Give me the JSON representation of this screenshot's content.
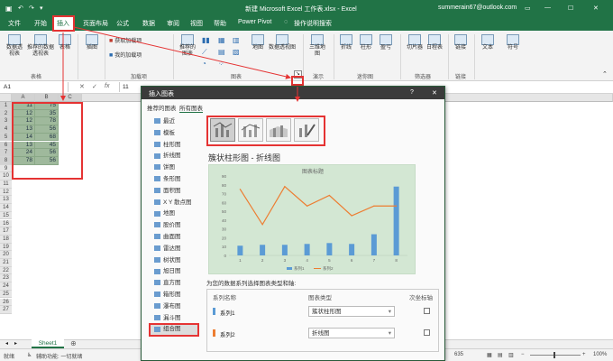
{
  "window": {
    "title": "新建 Microsoft Excel 工作表.xlsx - Excel",
    "account": "summerain67@outlook.com"
  },
  "tabs": [
    "文件",
    "开始",
    "插入",
    "页面布局",
    "公式",
    "数据",
    "审阅",
    "视图",
    "帮助",
    "Power Pivot",
    "操作说明搜索"
  ],
  "ribbon": {
    "groups": {
      "tables": "表格",
      "addins": "加载项",
      "charts": "图表",
      "tours": "演示",
      "sparklines": "迷你图",
      "filters": "筛选器",
      "links": "链接"
    },
    "buttons": {
      "pivot": "数据透视表",
      "rec_pivot": "推荐的数据透视表",
      "table": "表格",
      "illustrations": "插图",
      "get_addins": "获取加载项",
      "my_addins": "我的加载项",
      "rec_charts": "推荐的图表",
      "maps": "地图",
      "pivot_chart": "数据透视图",
      "map3d": "三维地图",
      "line": "折线",
      "column": "柱形",
      "winloss": "盈亏",
      "slicer": "切片器",
      "timeline": "日程表",
      "link": "链接",
      "text": "文本",
      "symbol": "符号"
    }
  },
  "formula_bar": {
    "name_box": "A1",
    "fx": "fx",
    "value": "11"
  },
  "sheet": {
    "columns": [
      "A",
      "B",
      "C",
      "D"
    ],
    "rows": [
      "1",
      "2",
      "3",
      "4",
      "5",
      "6",
      "7",
      "8",
      "9",
      "10",
      "11",
      "12",
      "13",
      "14",
      "15",
      "16",
      "17",
      "18",
      "19",
      "20",
      "21",
      "22",
      "23",
      "24",
      "25",
      "26",
      "27"
    ],
    "data": [
      [
        "11",
        "75"
      ],
      [
        "12",
        "35"
      ],
      [
        "12",
        "78"
      ],
      [
        "13",
        "56"
      ],
      [
        "14",
        "68"
      ],
      [
        "13",
        "45"
      ],
      [
        "24",
        "56"
      ],
      [
        "78",
        "56"
      ]
    ]
  },
  "sheet_tab": "Sheet1",
  "status": {
    "left": "就绪",
    "accessibility": "辅助功能: 一切就绪",
    "count": "635",
    "zoom": "100%"
  },
  "dialog": {
    "title": "插入图表",
    "help": "?",
    "close": "✕",
    "tabs": [
      "推荐的图表",
      "所有图表"
    ],
    "sidebar": [
      "最近",
      "模板",
      "柱形图",
      "折线图",
      "饼图",
      "条形图",
      "面积图",
      "X Y 散点图",
      "地图",
      "股价图",
      "曲面图",
      "雷达图",
      "树状图",
      "旭日图",
      "直方图",
      "箱形图",
      "瀑布图",
      "漏斗图",
      "组合图"
    ],
    "subtype_title": "簇状柱形图 - 折线图",
    "series_prompt": "为您的数据系列选择图表类型和轴:",
    "series_headers": [
      "系列名称",
      "图表类型",
      "次坐标轴"
    ],
    "series": [
      {
        "name": "系列1",
        "type": "簇状柱形图",
        "color": "#5b9bd5"
      },
      {
        "name": "系列2",
        "type": "折线图",
        "color": "#ed7d31"
      }
    ]
  },
  "chart_data": {
    "type": "bar",
    "title": "图表标题",
    "categories": [
      "1",
      "2",
      "3",
      "4",
      "5",
      "6",
      "7",
      "8"
    ],
    "series": [
      {
        "name": "系列1",
        "type": "bar",
        "values": [
          11,
          12,
          12,
          13,
          14,
          13,
          24,
          78
        ],
        "color": "#5b9bd5"
      },
      {
        "name": "系列2",
        "type": "line",
        "values": [
          75,
          35,
          78,
          56,
          68,
          45,
          56,
          56
        ],
        "color": "#ed7d31"
      }
    ],
    "yticks": [
      "0",
      "10",
      "20",
      "30",
      "40",
      "50",
      "60",
      "70",
      "80",
      "90"
    ],
    "ylim": [
      0,
      90
    ],
    "legend": "bottom",
    "grid": false
  }
}
